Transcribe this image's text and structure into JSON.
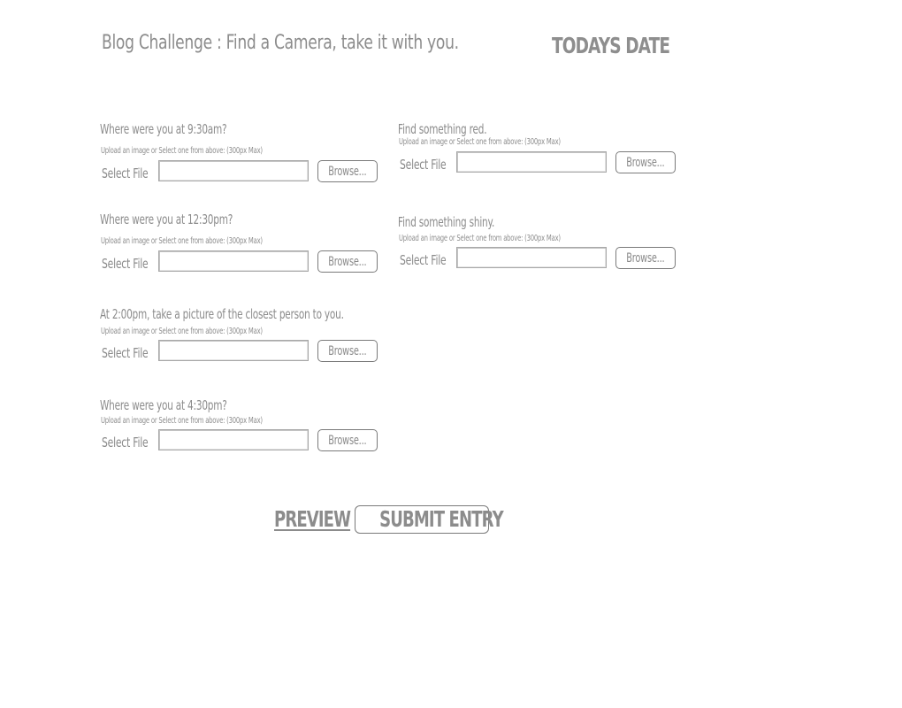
{
  "header": {
    "title": "Blog Challenge : Find a Camera, take it with you.",
    "date_label": "TODAYS DATE"
  },
  "challenges": {
    "q1": {
      "question": "Where were you at 9:30am?",
      "hint": "Upload an image or Select one from above:  (300px Max)",
      "select_label": "Select File",
      "input_value": "",
      "browse_label": "Browse..."
    },
    "q2": {
      "question": "Where were you at 12:30pm?",
      "hint": "Upload an image or Select one from above:  (300px Max)",
      "select_label": "Select File",
      "input_value": "",
      "browse_label": "Browse..."
    },
    "q3": {
      "question": "At 2:00pm, take a picture of the closest person to you.",
      "hint": "Upload an image or Select one from above:  (300px Max)",
      "select_label": "Select File",
      "input_value": "",
      "browse_label": "Browse..."
    },
    "q4": {
      "question": "Where were you at 4:30pm?",
      "hint": "Upload an image or Select one from above:  (300px Max)",
      "select_label": "Select File",
      "input_value": "",
      "browse_label": "Browse..."
    },
    "q5": {
      "question": "Find something red.",
      "hint": "Upload an image or Select one from above:  (300px Max)",
      "select_label": "Select File",
      "input_value": "",
      "browse_label": "Browse..."
    },
    "q6": {
      "question": "Find something shiny.",
      "hint": "Upload an image or Select one from above:  (300px Max)",
      "select_label": "Select File",
      "input_value": "",
      "browse_label": "Browse..."
    }
  },
  "actions": {
    "preview_label": "PREVIEW",
    "submit_label": "SUBMIT ENTRY"
  }
}
